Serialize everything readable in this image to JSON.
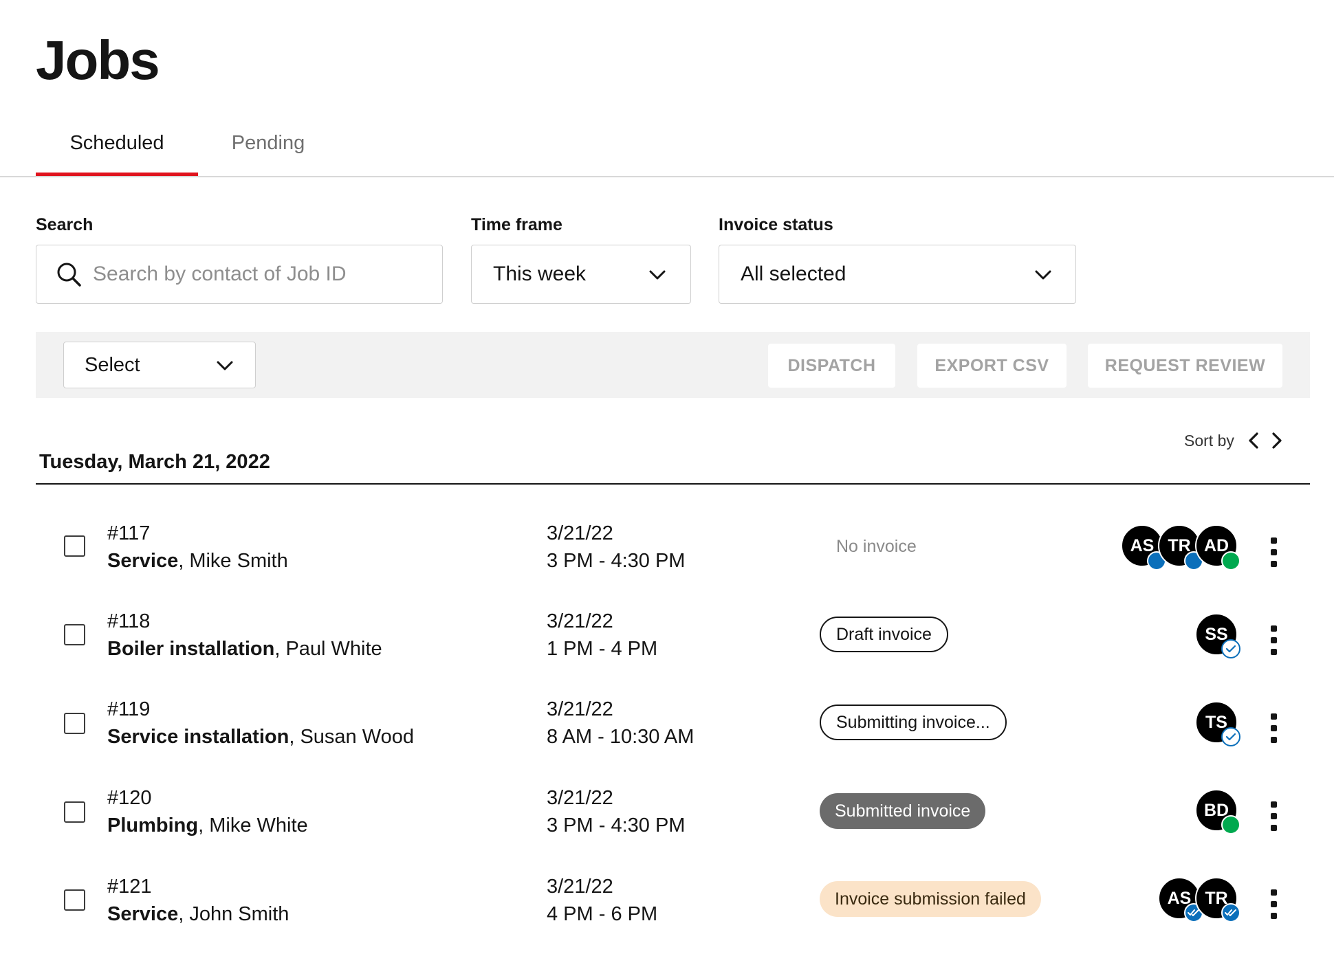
{
  "page": {
    "title": "Jobs"
  },
  "tabs": [
    {
      "label": "Scheduled",
      "active": true
    },
    {
      "label": "Pending",
      "active": false
    }
  ],
  "filters": {
    "search": {
      "label": "Search",
      "placeholder": "Search by contact of Job ID",
      "value": ""
    },
    "timeframe": {
      "label": "Time frame",
      "value": "This week"
    },
    "invoice_status": {
      "label": "Invoice status",
      "value": "All selected"
    }
  },
  "toolbar": {
    "select_label": "Select",
    "buttons": {
      "dispatch": "DISPATCH",
      "export": "EXPORT CSV",
      "review": "REQUEST REVIEW"
    }
  },
  "sort": {
    "label": "Sort by"
  },
  "day": {
    "label": "Tuesday, March 21, 2022"
  },
  "colors": {
    "accent": "#e0141e",
    "status_blue": "#0b6fba",
    "status_green": "#00a94f",
    "failed_bg": "#fbe3c8"
  },
  "jobs": [
    {
      "id": "#117",
      "type": "Service",
      "contact": ", Mike Smith",
      "date": "3/21/22",
      "time": "3 PM - 4:30 PM",
      "invoice": "No invoice",
      "assignees": [
        {
          "initials": "AS",
          "status": "blue"
        },
        {
          "initials": "TR",
          "status": "blue"
        },
        {
          "initials": "AD",
          "status": "green"
        }
      ]
    },
    {
      "id": "#118",
      "type": "Boiler installation",
      "contact": ", Paul White",
      "date": "3/21/22",
      "time": "1 PM - 4 PM",
      "invoice": "Draft invoice",
      "assignees": [
        {
          "initials": "SS",
          "status": "check"
        }
      ]
    },
    {
      "id": "#119",
      "type": "Service installation",
      "contact": ", Susan Wood",
      "date": "3/21/22",
      "time": "8 AM - 10:30 AM",
      "invoice": "Submitting invoice...",
      "assignees": [
        {
          "initials": "TS",
          "status": "check"
        }
      ]
    },
    {
      "id": "#120",
      "type": "Plumbing",
      "contact": ", Mike White",
      "date": "3/21/22",
      "time": "3 PM - 4:30 PM",
      "invoice": "Submitted invoice",
      "assignees": [
        {
          "initials": "BD",
          "status": "green"
        }
      ]
    },
    {
      "id": "#121",
      "type": "Service",
      "contact": ", John Smith",
      "date": "3/21/22",
      "time": "4 PM - 6 PM",
      "invoice": "Invoice submission failed",
      "assignees": [
        {
          "initials": "AS",
          "status": "double-check"
        },
        {
          "initials": "TR",
          "status": "double-check"
        }
      ]
    }
  ]
}
